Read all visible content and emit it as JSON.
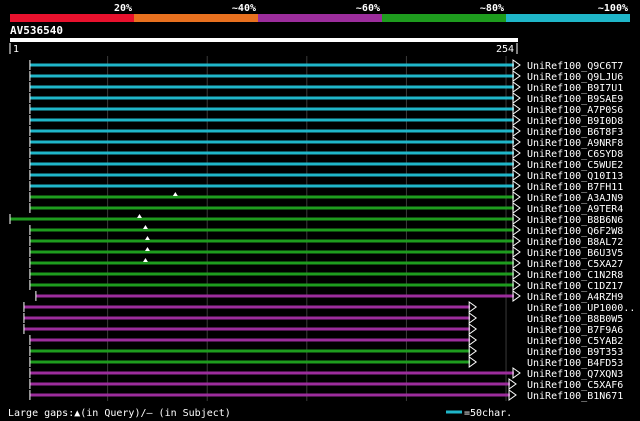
{
  "legend": {
    "segments": [
      {
        "label": "20%",
        "color": "#e8112d"
      },
      {
        "label": "~40%",
        "color": "#e8711f"
      },
      {
        "label": "~60%",
        "color": "#9c2d9c"
      },
      {
        "label": "~80%",
        "color": "#1e9c1e"
      },
      {
        "label": "~100%",
        "color": "#1fb6c9"
      }
    ]
  },
  "query": {
    "name": "AV536540",
    "start_label": "1",
    "end_label": "254",
    "length": 254
  },
  "colors": {
    "cyan": "#1fb6c9",
    "green": "#1e9c1e",
    "purple": "#9c2d9c",
    "ruler": "#ffffff",
    "grid": "#3a3a3a",
    "gap_marker": "#ffffff"
  },
  "hits": [
    {
      "name": "UniRef100_Q9C6T7",
      "start": 11,
      "end": 254,
      "color": "cyan",
      "arrow": true
    },
    {
      "name": "UniRef100_Q9LJU6",
      "start": 11,
      "end": 254,
      "color": "cyan",
      "arrow": true
    },
    {
      "name": "UniRef100_B9I7U1",
      "start": 11,
      "end": 254,
      "color": "cyan",
      "arrow": true
    },
    {
      "name": "UniRef100_B9SAE9",
      "start": 11,
      "end": 254,
      "color": "cyan",
      "arrow": true
    },
    {
      "name": "UniRef100_A7P0S6",
      "start": 11,
      "end": 254,
      "color": "cyan",
      "arrow": true
    },
    {
      "name": "UniRef100_B9I0D8",
      "start": 11,
      "end": 254,
      "color": "cyan",
      "arrow": true
    },
    {
      "name": "UniRef100_B6T8F3",
      "start": 11,
      "end": 254,
      "color": "cyan",
      "arrow": true
    },
    {
      "name": "UniRef100_A9NRF8",
      "start": 11,
      "end": 254,
      "color": "cyan",
      "arrow": true
    },
    {
      "name": "UniRef100_C6SYD8",
      "start": 11,
      "end": 254,
      "color": "cyan",
      "arrow": true
    },
    {
      "name": "UniRef100_C5WUE2",
      "start": 11,
      "end": 254,
      "color": "cyan",
      "arrow": true
    },
    {
      "name": "UniRef100_Q10I13",
      "start": 11,
      "end": 254,
      "color": "cyan",
      "arrow": true
    },
    {
      "name": "UniRef100_B7FH11",
      "start": 11,
      "end": 254,
      "color": "cyan",
      "arrow": true
    },
    {
      "name": "UniRef100_A3AJN9",
      "start": 11,
      "end": 254,
      "color": "green",
      "arrow": true,
      "gap": 84
    },
    {
      "name": "UniRef100_A9TER4",
      "start": 11,
      "end": 254,
      "color": "green",
      "arrow": true
    },
    {
      "name": "UniRef100_B8B6N6",
      "start": 1,
      "end": 254,
      "color": "green",
      "arrow": true,
      "gap": 66
    },
    {
      "name": "UniRef100_Q6F2W8",
      "start": 11,
      "end": 254,
      "color": "green",
      "arrow": true,
      "gap": 69
    },
    {
      "name": "UniRef100_B8AL72",
      "start": 11,
      "end": 254,
      "color": "green",
      "arrow": true,
      "gap": 70
    },
    {
      "name": "UniRef100_B6U3V5",
      "start": 11,
      "end": 254,
      "color": "green",
      "arrow": true,
      "gap": 70
    },
    {
      "name": "UniRef100_C5XA27",
      "start": 11,
      "end": 254,
      "color": "green",
      "arrow": true,
      "gap": 69
    },
    {
      "name": "UniRef100_C1N2R8",
      "start": 11,
      "end": 254,
      "color": "green",
      "arrow": true
    },
    {
      "name": "UniRef100_C1DZ17",
      "start": 11,
      "end": 254,
      "color": "green",
      "arrow": true
    },
    {
      "name": "UniRef100_A4RZH9",
      "start": 14,
      "end": 254,
      "color": "purple",
      "arrow": true
    },
    {
      "name": "UniRef100_UP1000..",
      "start": 8,
      "end": 232,
      "color": "purple",
      "arrow": true
    },
    {
      "name": "UniRef100_B8B0W5",
      "start": 8,
      "end": 232,
      "color": "purple",
      "arrow": true
    },
    {
      "name": "UniRef100_B7F9A6",
      "start": 8,
      "end": 232,
      "color": "purple",
      "arrow": true
    },
    {
      "name": "UniRef100_C5YAB2",
      "start": 11,
      "end": 232,
      "color": "purple",
      "arrow": true
    },
    {
      "name": "UniRef100_B9T353",
      "start": 11,
      "end": 232,
      "color": "green",
      "arrow": true
    },
    {
      "name": "UniRef100_B4FD53",
      "start": 11,
      "end": 232,
      "color": "green",
      "arrow": true
    },
    {
      "name": "UniRef100_Q7XQN3",
      "start": 11,
      "end": 254,
      "color": "purple",
      "arrow": true
    },
    {
      "name": "UniRef100_C5XAF6",
      "start": 11,
      "end": 252,
      "color": "purple",
      "arrow": true
    },
    {
      "name": "UniRef100_B1N671",
      "start": 11,
      "end": 252,
      "color": "purple",
      "arrow": true
    }
  ],
  "footer": {
    "gaps_label": "Large gaps:",
    "query_marker": "▲",
    "query_text": "(in Query)/",
    "subject_marker": "–",
    "subject_text": " (in Subject)",
    "scale_text": "=50char."
  }
}
